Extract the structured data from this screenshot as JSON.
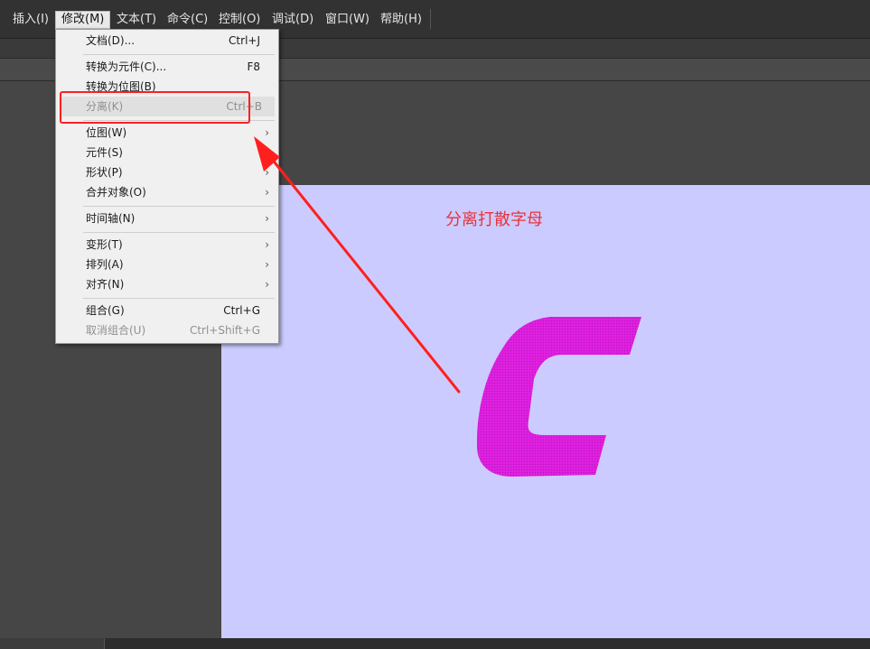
{
  "menubar": {
    "items": [
      {
        "label": "插入(I)"
      },
      {
        "label": "修改(M)"
      },
      {
        "label": "文本(T)"
      },
      {
        "label": "命令(C)"
      },
      {
        "label": "控制(O)"
      },
      {
        "label": "调试(D)"
      },
      {
        "label": "窗口(W)"
      },
      {
        "label": "帮助(H)"
      }
    ]
  },
  "menu": {
    "items": [
      {
        "label": "文档(D)...",
        "shortcut": "Ctrl+J"
      },
      {
        "label": "转换为元件(C)...",
        "shortcut": "F8"
      },
      {
        "label": "转换为位图(B)",
        "shortcut": ""
      },
      {
        "label": "分离(K)",
        "shortcut": "Ctrl+B",
        "disabled": true
      },
      {
        "label": "位图(W)",
        "submenu": true
      },
      {
        "label": "元件(S)",
        "submenu": false
      },
      {
        "label": "形状(P)",
        "submenu": true
      },
      {
        "label": "合并对象(O)",
        "submenu": true
      },
      {
        "label": "时间轴(N)",
        "submenu": true
      },
      {
        "label": "变形(T)",
        "submenu": true
      },
      {
        "label": "排列(A)",
        "submenu": true
      },
      {
        "label": "对齐(N)",
        "submenu": true
      },
      {
        "label": "组合(G)",
        "shortcut": "Ctrl+G"
      },
      {
        "label": "取消组合(U)",
        "shortcut": "Ctrl+Shift+G",
        "disabled": true
      }
    ],
    "submenu_arrow": "›"
  },
  "stage": {
    "annotation": "分离打散字母",
    "background": "#cccbff",
    "letter_color": "#e020e0"
  },
  "colors": {
    "annotation_red": "#ff1f1f"
  },
  "icons": [
    "submenu-arrow-icon",
    "annotation-arrow-icon"
  ]
}
